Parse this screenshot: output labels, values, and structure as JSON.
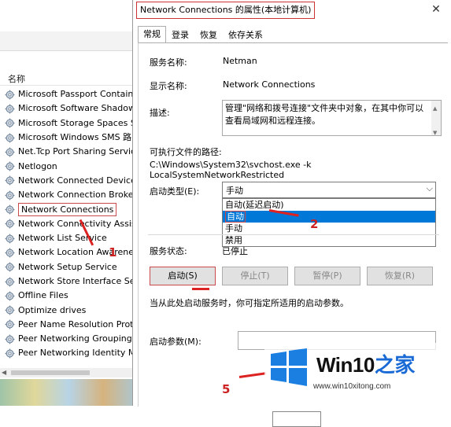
{
  "services": {
    "column_header": "名称",
    "items": [
      "Microsoft Passport Containe",
      "Microsoft Software Shadow",
      "Microsoft Storage Spaces SI",
      "Microsoft Windows SMS 路由",
      "Net.Tcp Port Sharing Service",
      "Netlogon",
      "Network Connected Devices",
      "Network Connection Broker",
      "Network Connections",
      "Network Connectivity Assista",
      "Network List Service",
      "Network Location Awarenes",
      "Network Setup Service",
      "Network Store Interface Ser",
      "Offline Files",
      "Optimize drives",
      "Peer Name Resolution Proto",
      "Peer Networking Grouping",
      "Peer Networking Identity Ma"
    ],
    "selected": "Network Connections"
  },
  "dialog": {
    "title": "Network Connections 的属性(本地计算机)",
    "close_icon": "close-icon",
    "tabs": [
      "常规",
      "登录",
      "恢复",
      "依存关系"
    ],
    "active_tab": "常规",
    "service_name_label": "服务名称:",
    "service_name": "Netman",
    "display_name_label": "显示名称:",
    "display_name": "Network Connections",
    "description_label": "描述:",
    "description": "管理\"网络和拨号连接\"文件夹中对象，在其中你可以查看局域网和远程连接。",
    "exe_path_label": "可执行文件的路径:",
    "exe_path": "C:\\Windows\\System32\\svchost.exe -k LocalSystemNetworkRestricted",
    "startup_type_label": "启动类型(E):",
    "startup_type_value": "手动",
    "startup_options": [
      "自动(延迟启动)",
      "自动",
      "手动",
      "禁用"
    ],
    "highlighted_option": "自动",
    "service_status_label": "服务状态:",
    "service_status": "已停止",
    "buttons": {
      "start": "启动(S)",
      "stop": "停止(T)",
      "pause": "暂停(P)",
      "resume": "恢复(R)"
    },
    "hint": "当从此处启动服务时，你可指定所适用的启动参数。",
    "start_params_label": "启动参数(M):"
  },
  "annotations": {
    "step1": "1",
    "step2": "2",
    "step5": "5"
  },
  "watermark": {
    "text_main": "Win10",
    "text_accent": "之家",
    "url": "www.win10xitong.com"
  },
  "colors": {
    "highlight": "#0078d7",
    "annotation_red": "#dd2222",
    "logo_blue": "#1a7fe0"
  }
}
